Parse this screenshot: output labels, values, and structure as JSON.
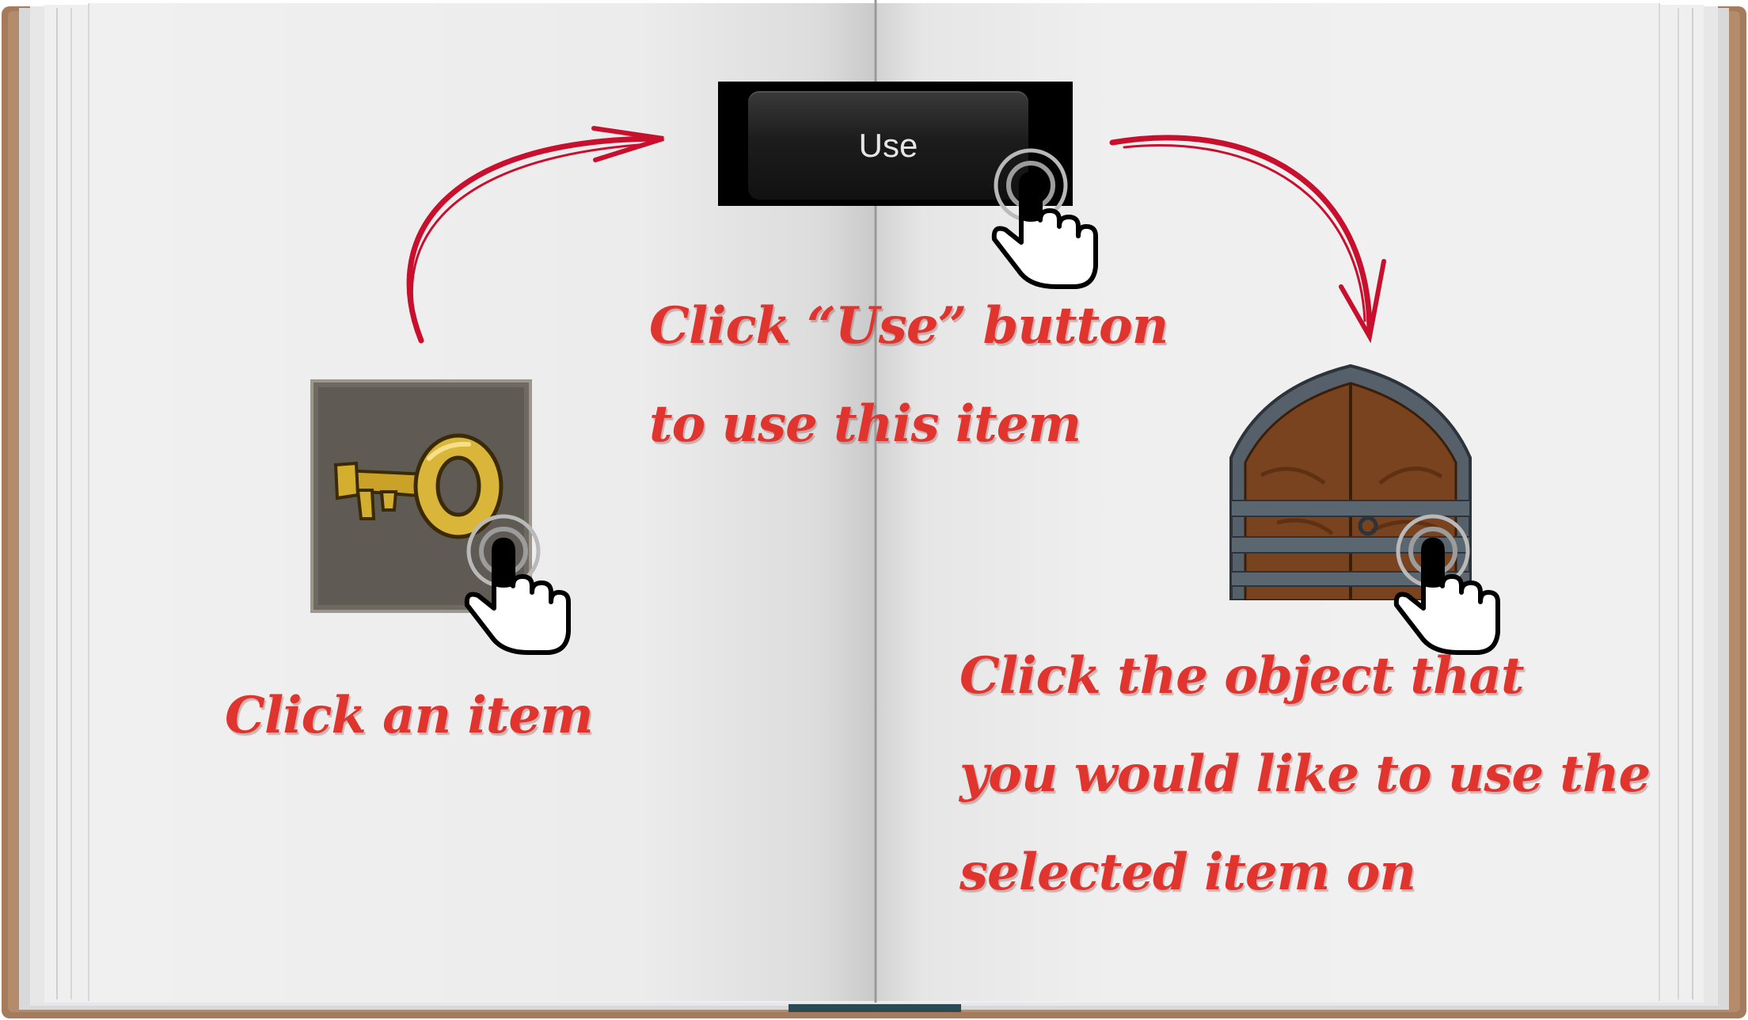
{
  "buttons": {
    "use_label": "Use"
  },
  "hints": {
    "step1": "Click an item",
    "step2_lines": [
      "Click “Use” button",
      "to use this item"
    ],
    "step3_lines": [
      "Click the object that",
      "you would like to use the",
      "selected item on"
    ]
  },
  "icons": {
    "item": "golden-key-icon",
    "target": "wooden-door-icon",
    "pointer": "tap-hand-icon",
    "arrows": "curved-arrow-icon"
  },
  "colors": {
    "hint_text": "#e0342e",
    "arrow": "#c8102e"
  }
}
